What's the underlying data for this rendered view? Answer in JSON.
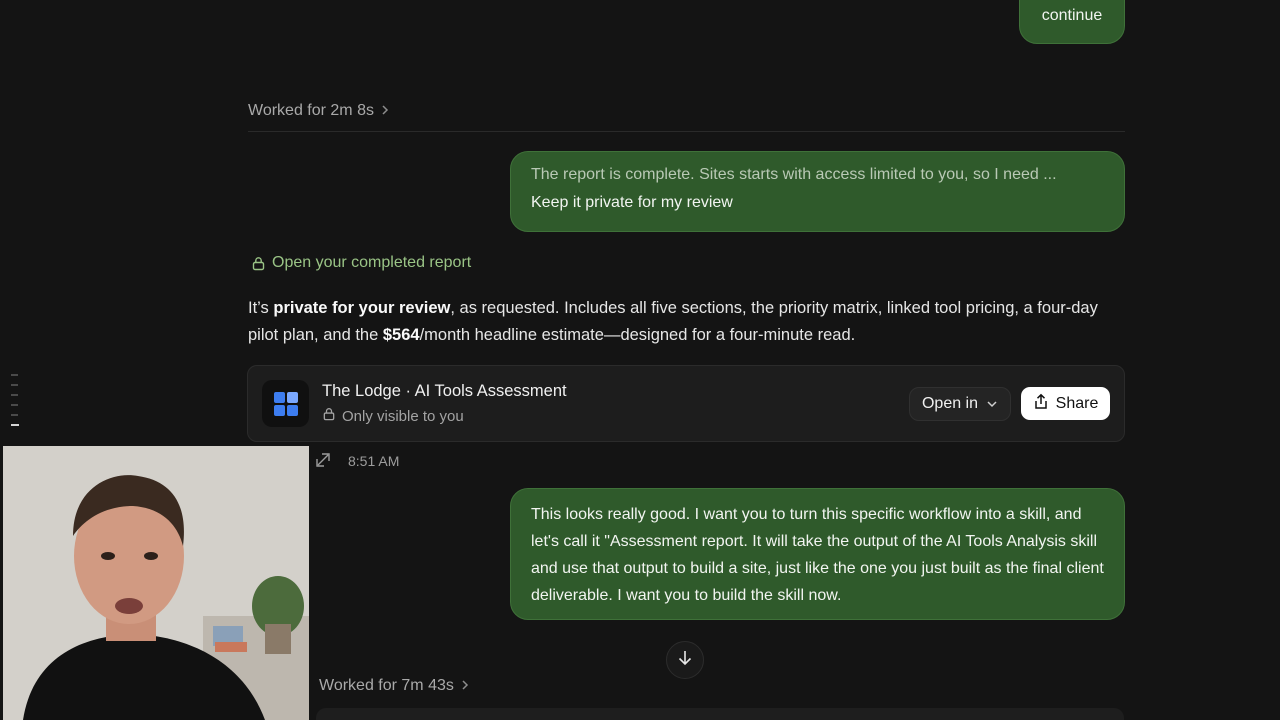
{
  "messages": {
    "continue": "continue",
    "complete_quote": "The report is complete. Sites starts with access limited to you, so I need ...",
    "complete_answer": "Keep it private for my review",
    "request": "This looks really good. I want you to turn this specific workflow into a skill, and let's call it \"Assessment report. It will take the output of the AI Tools Analysis skill and use that output to build a site, just like the one you just built as the final client deliverable. I want you to build the skill now."
  },
  "worked": {
    "first": "Worked for 2m 8s",
    "second": "Worked for 7m 43s"
  },
  "open_report": "Open your completed report",
  "summary": {
    "p1": "It’s ",
    "b1": "private for your review",
    "p2": ", as requested. Includes all five sections, the priority matrix, linked tool pricing, a four-day pilot plan, and the ",
    "b2": "$564",
    "p3": "/month headline estimate—designed for a four-minute read."
  },
  "card": {
    "title": "The Lodge · AI Tools Assessment",
    "visibility": "Only visible to you",
    "open_in": "Open in",
    "share": "Share"
  },
  "timestamp": "8:51 AM",
  "icons": [
    "chevron-right-icon",
    "lock-icon",
    "app-grid-icon",
    "chevron-down-icon",
    "share-icon",
    "expand-icon",
    "arrow-down-icon"
  ],
  "colors": {
    "bubble": "#2f5a2b",
    "accent_green": "#9ac486",
    "background": "#141414",
    "card": "#1d1d1d",
    "app_icon_blue": "#3d7df0"
  }
}
